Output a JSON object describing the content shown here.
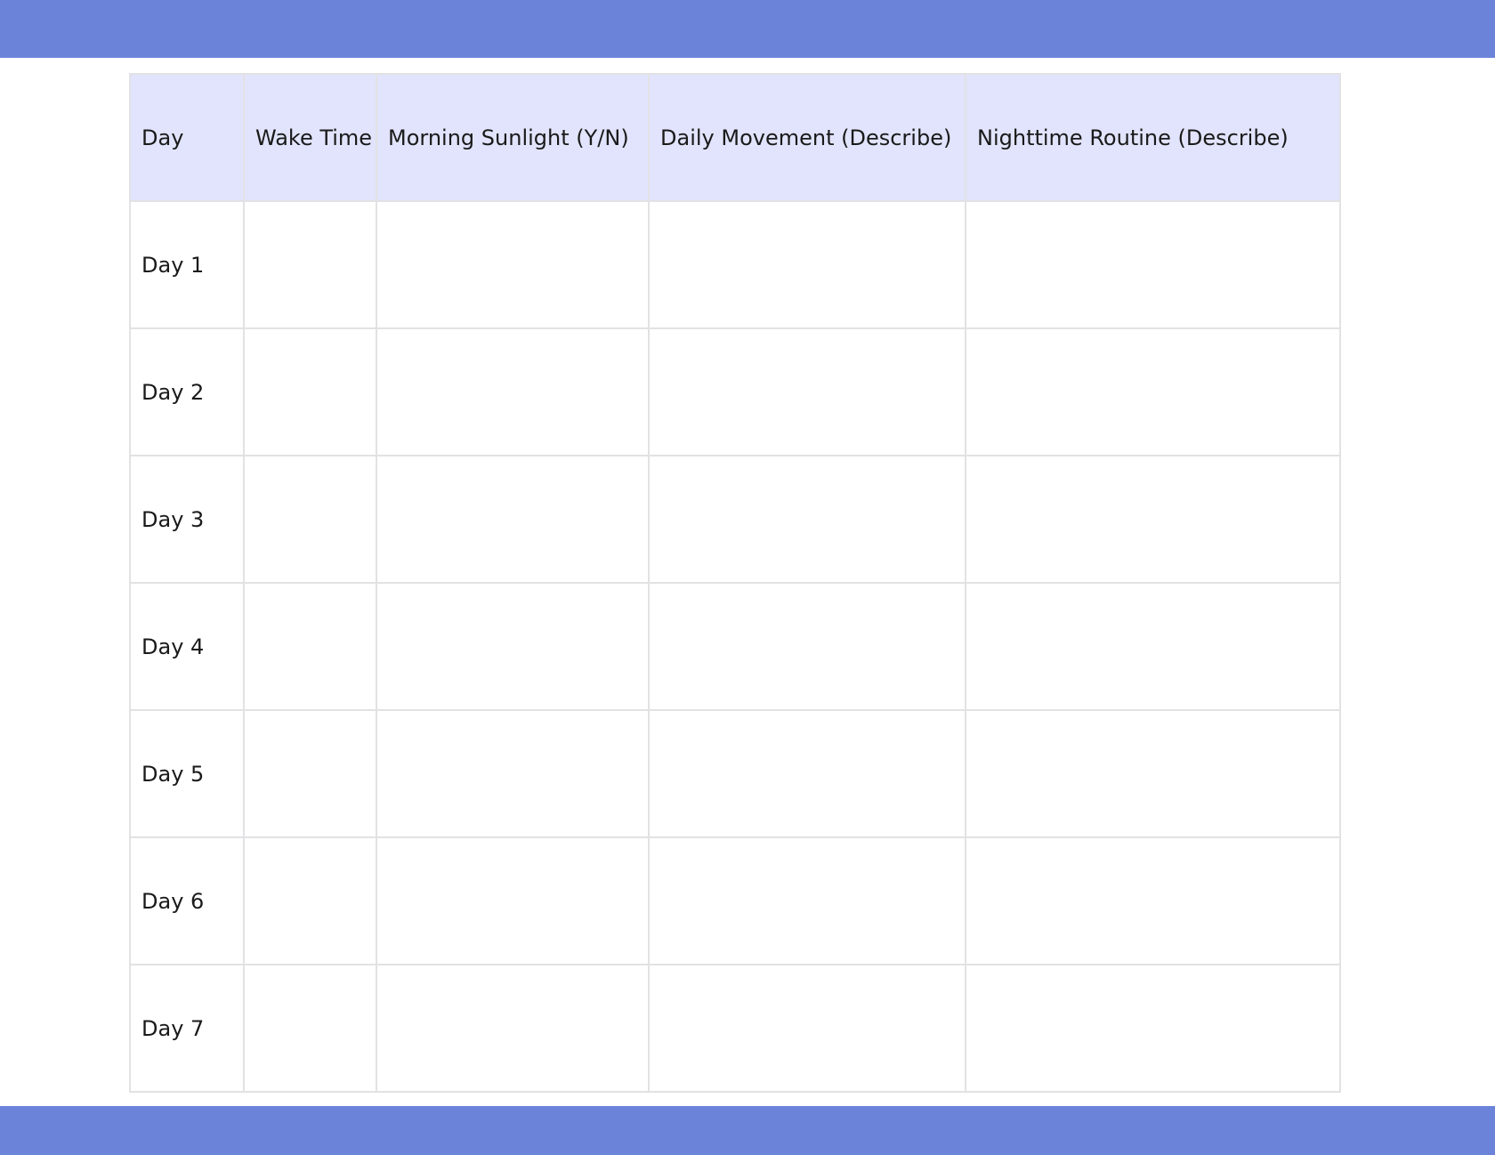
{
  "colors": {
    "band": "#6b84da",
    "header_bg": "#e1e4fc",
    "grid_line": "#e2e2e4",
    "text": "#1a1a1a"
  },
  "table": {
    "headers": [
      "Day",
      "Wake Time",
      "Morning Sunlight (Y/N)",
      "Daily Movement (Describe)",
      "Nighttime Routine (Describe)"
    ],
    "rows": [
      [
        "Day 1",
        "",
        "",
        "",
        ""
      ],
      [
        "Day 2",
        "",
        "",
        "",
        ""
      ],
      [
        "Day 3",
        "",
        "",
        "",
        ""
      ],
      [
        "Day 4",
        "",
        "",
        "",
        ""
      ],
      [
        "Day 5",
        "",
        "",
        "",
        ""
      ],
      [
        "Day 6",
        "",
        "",
        "",
        ""
      ],
      [
        "Day 7",
        "",
        "",
        "",
        ""
      ]
    ]
  }
}
